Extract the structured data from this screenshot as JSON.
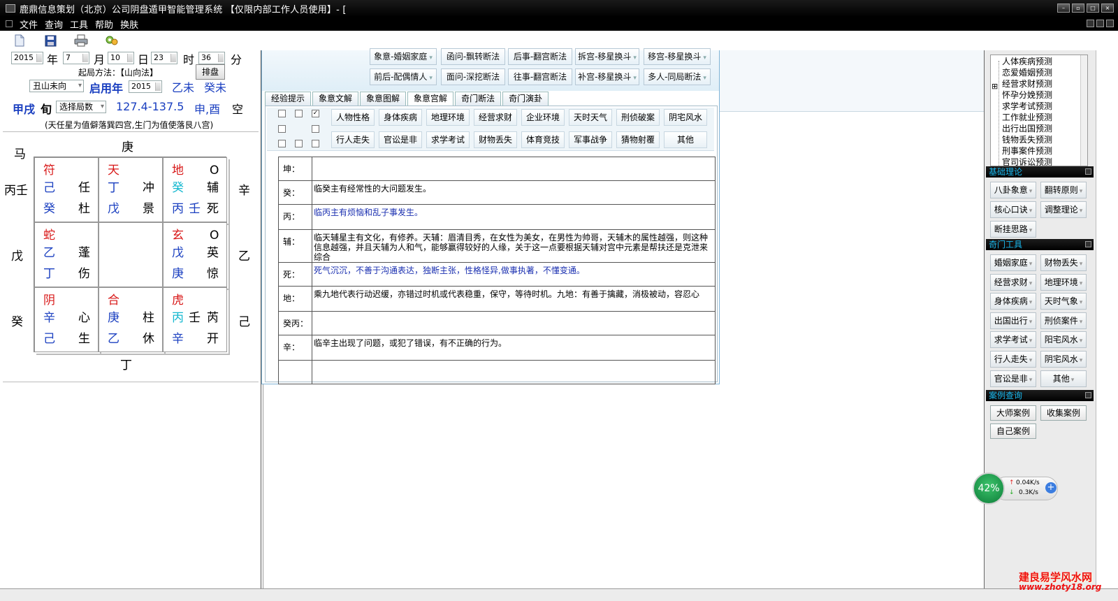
{
  "window": {
    "title": "鹿鼎信息策划（北京）公司阴盘遁甲智能管理系统  【仅限内部工作人员使用】- [",
    "menu": [
      "文件",
      "查询",
      "工具",
      "帮助",
      "换肤"
    ]
  },
  "toolbar": {
    "icons": [
      "new-file-icon",
      "save-icon",
      "print-icon",
      "tools-icon"
    ]
  },
  "datetime": {
    "year": "2015",
    "year_label": "年",
    "month": "7",
    "month_label": "月",
    "day": "10",
    "day_label": "日",
    "hour": "23",
    "hour_label": "时",
    "minute": "36",
    "minute_label": "分"
  },
  "method": {
    "label": "起局方法：【山向法】",
    "arrange_button": "排盘",
    "mountain": "丑山未向",
    "use_year_label": "启用年",
    "use_year": "2015",
    "gz1": "乙未",
    "gz2": "癸未",
    "xun_label1": "甲戌",
    "xun_label2": "旬",
    "select_ju": "选择局数",
    "range": "127.4-137.5",
    "empty": "申,酉",
    "empty_label": "空",
    "note": "(天任星为值僻落巽四宫,生门为值使落艮八宫)"
  },
  "palace": {
    "horse": "马",
    "top": "庚",
    "bottom": "丁",
    "left": [
      "丙壬",
      "戊",
      "癸"
    ],
    "right": [
      "辛",
      "乙",
      "己"
    ],
    "cells": [
      {
        "god": "符",
        "o": "",
        "stem1": "己",
        "star": "任",
        "stem2": "癸",
        "door": "杜"
      },
      {
        "god": "天",
        "o": "",
        "stem1": "丁",
        "star": "冲",
        "stem2": "戊",
        "door": "景"
      },
      {
        "god": "地",
        "o": "O",
        "stem1": "癸",
        "star": "辅",
        "stem2": "丙",
        "stem2b": "壬",
        "door": "死"
      },
      {
        "god": "蛇",
        "o": "",
        "stem1": "乙",
        "star": "蓬",
        "stem2": "丁",
        "door": "伤"
      },
      {
        "god": "",
        "o": "",
        "stem1": "",
        "star": "",
        "stem2": "",
        "door": ""
      },
      {
        "god": "玄",
        "o": "O",
        "stem1": "戊",
        "star": "英",
        "stem2": "庚",
        "door": "惊"
      },
      {
        "god": "阴",
        "o": "",
        "stem1": "辛",
        "star": "心",
        "stem2": "己",
        "door": "生"
      },
      {
        "god": "合",
        "o": "",
        "stem1": "庚",
        "star": "柱",
        "stem2": "乙",
        "door": "休"
      },
      {
        "god": "虎",
        "o": "",
        "stem1": "丙",
        "stem1b": "壬",
        "star": "芮",
        "stem2": "辛",
        "door": "开"
      }
    ]
  },
  "center_buttons": {
    "row1": [
      "象意-婚姻家庭",
      "函问-飘转断法",
      "后事-翻宫断法",
      "拆宫-移星换斗",
      "移宫-移星换斗"
    ],
    "row2": [
      "前后-配偶情人",
      "面问-深挖断法",
      "往事-翻宫断法",
      "补宫-移星换斗",
      "多人-同局断法"
    ]
  },
  "tabs": [
    "经验提示",
    "象意文解",
    "象意图解",
    "象意宫解",
    "奇门断法",
    "奇门演卦"
  ],
  "categories": {
    "row1": [
      "人物性格",
      "身体疾病",
      "地理环境",
      "经营求财",
      "企业环境",
      "天时天气",
      "刑侦破案",
      "阴宅风水"
    ],
    "row2": [
      "行人走失",
      "官讼是非",
      "求学考试",
      "财物丢失",
      "体育竞技",
      "军事战争",
      "猜物射覆",
      "其他"
    ]
  },
  "interpretation": [
    {
      "key": "坤：",
      "text": "",
      "color": "#000000"
    },
    {
      "key": "癸：",
      "text": "临癸主有经常性的大问题发生。",
      "color": "#000000"
    },
    {
      "key": "丙：",
      "text": "临丙主有烦恼和乱子事发生。",
      "color": "#1a2fb0"
    },
    {
      "key": "辅：",
      "text": "临天辅星主有文化，有修养。天辅：眉清目秀，在女性为美女，在男性为帅哥，天辅木的属性越强，则这种信息越强，并且天辅为人和气，能够赢得较好的人缘，关于这一点要根据天辅对宫中元素是帮扶还是克泄来综合",
      "color": "#000000"
    },
    {
      "key": "死：",
      "text": "死气沉沉，不善于沟通表达，独断主张，性格怪异,做事执著，不懂变通。",
      "color": "#1a2fb0"
    },
    {
      "key": "地：",
      "text": "乘九地代表行动迟缓，亦错过时机或代表稳重，保守，等待时机。九地：有善于擒藏，消极被动，容忍心",
      "color": "#000000"
    },
    {
      "key": "癸丙：",
      "text": "",
      "color": "#000000"
    },
    {
      "key": "辛：",
      "text": "临辛主出现了问题，或犯了错误，有不正确的行为。",
      "color": "#000000"
    },
    {
      "key": "",
      "text": "",
      "color": "#000000"
    }
  ],
  "right_panel": {
    "tree": [
      "人体疾病预测",
      "恋爱婚姻预测",
      "经营求财预测",
      "怀孕分娩预测",
      "求学考试预测",
      "工作就业预测",
      "出行出国预测",
      "钱物丢失预测",
      "刑事案件预测",
      "官司诉讼预测"
    ],
    "tree_expand": "⊞",
    "sec1": {
      "title": "基础理论",
      "buttons": [
        "八卦象意",
        "翻转原则",
        "核心口诀",
        "调整理论",
        "断挂思路"
      ]
    },
    "sec2": {
      "title": "奇门工具",
      "buttons": [
        "婚姻家庭",
        "财物丢失",
        "经营求财",
        "地理环境",
        "身体疾病",
        "天时气象",
        "出国出行",
        "刑侦案件",
        "求学考试",
        "阳宅风水",
        "行人走失",
        "阴宅风水",
        "官讼是非",
        "其他"
      ]
    },
    "sec3": {
      "title": "案例查询",
      "buttons": [
        "大师案例",
        "收集案例",
        "自己案例"
      ]
    }
  },
  "speed_widget": {
    "percent": "42%",
    "up": "0.04K/s",
    "down": "0.3K/s",
    "plus": "+"
  },
  "watermark": {
    "line1": "建良易学风水网",
    "line2": "www.zhoty18.org"
  },
  "colors": {
    "red": "#d81818",
    "blue": "#1a3fc0",
    "cyan": "#15b8d0",
    "accent": "#19b8ee"
  }
}
